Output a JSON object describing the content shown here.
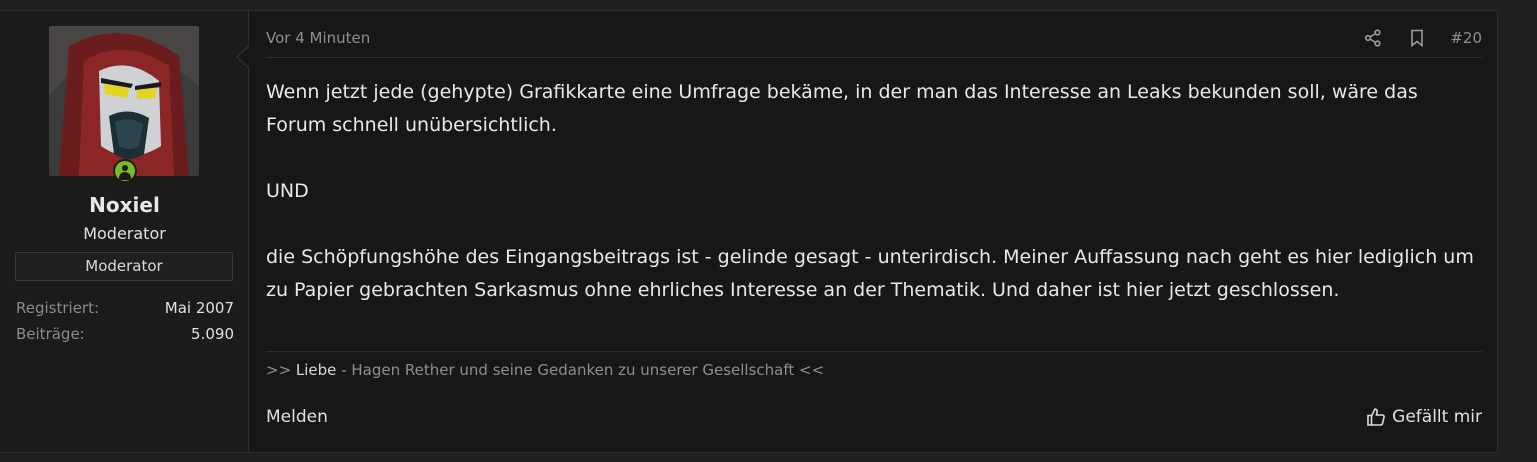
{
  "user": {
    "name": "Noxiel",
    "title": "Moderator",
    "banner": "Moderator",
    "stats": [
      {
        "label": "Registriert:",
        "value": "Mai 2007"
      },
      {
        "label": "Beiträge:",
        "value": "5.090"
      }
    ],
    "avatar_icon": "avatar-image",
    "online_icon": "online-status-icon"
  },
  "post": {
    "time": "Vor 4 Minuten",
    "number": "#20",
    "paragraphs": [
      "Wenn jetzt jede (gehypte) Grafikkarte eine Umfrage bekäme, in der man das Interesse an Leaks bekunden soll, wäre das Forum schnell unübersichtlich.",
      "UND",
      "die Schöpfungshöhe des Eingangsbeitrags ist - gelinde gesagt - unterirdisch. Meiner Auffassung nach geht es hier lediglich um zu Papier gebrachten Sarkasmus ohne ehrliches Interesse an der Thematik. Und daher ist hier jetzt geschlossen."
    ],
    "signature": {
      "prefix": ">> ",
      "link": "Liebe",
      "suffix": " - Hagen Rether und seine Gedanken zu unserer Gesellschaft <<"
    }
  },
  "footer": {
    "report": "Melden",
    "like": "Gefällt mir"
  },
  "colors": {
    "online": "#7ab82d",
    "background": "#171717"
  }
}
